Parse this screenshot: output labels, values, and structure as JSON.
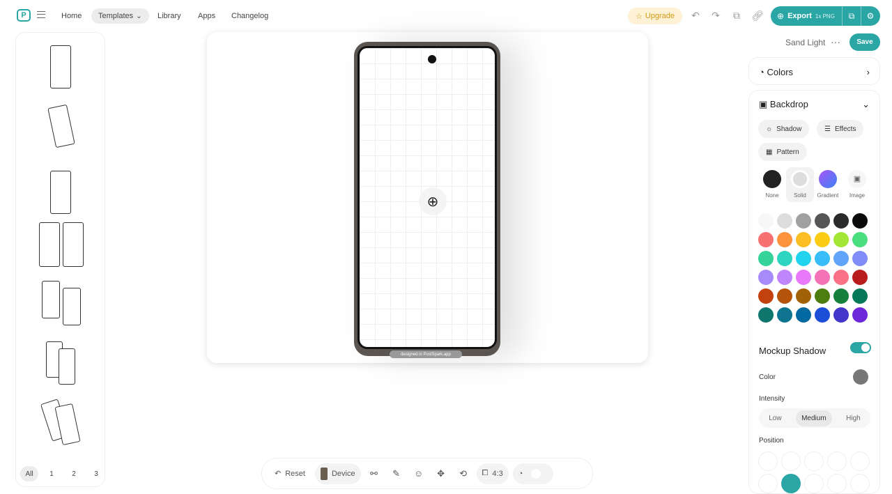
{
  "topbar": {
    "logo": "P",
    "nav": [
      "Home",
      "Templates",
      "Library",
      "Apps",
      "Changelog"
    ],
    "templates_suffix": "⌄",
    "upgrade": "Upgrade",
    "export_label": "Export",
    "export_meta": "1x PNG"
  },
  "sidebar": {
    "pages": [
      "All",
      "1",
      "2",
      "3"
    ]
  },
  "canvas": {
    "watermark": "designed in PostSpark.app"
  },
  "toolbar": {
    "reset": "Reset",
    "device": "Device",
    "ratio": "4:3"
  },
  "panel": {
    "theme": "Sand Light",
    "more": "···",
    "save": "Save",
    "colors": "Colors",
    "backdrop": "Backdrop",
    "chips": [
      "Shadow",
      "Effects",
      "Pattern"
    ],
    "bg_types": [
      "None",
      "Solid",
      "Gradient",
      "Image"
    ],
    "mockup_shadow": "Mockup Shadow",
    "color_label": "Color",
    "intensity_label": "Intensity",
    "intensity_options": [
      "Low",
      "Medium",
      "High"
    ],
    "intensity_selected": "Medium",
    "position_label": "Position"
  },
  "colors": {
    "accent": "#2aa6a5",
    "swatches": [
      "#f7f7f7",
      "#dddddd",
      "#a0a0a0",
      "#555555",
      "#2a2a2a",
      "#0a0a0a",
      "#f87171",
      "#fb923c",
      "#fbbf24",
      "#facc15",
      "#a3e635",
      "#4ade80",
      "#34d399",
      "#2dd4bf",
      "#22d3ee",
      "#38bdf8",
      "#60a5fa",
      "#818cf8",
      "#a78bfa",
      "#c084fc",
      "#e879f9",
      "#f472b6",
      "#fb7185",
      "#b91c1c",
      "#c2410c",
      "#b45309",
      "#a16207",
      "#4d7c0f",
      "#15803d",
      "#047857",
      "#0f766e",
      "#0e7490",
      "#0369a1",
      "#1d4ed8",
      "#4338ca",
      "#6d28d9"
    ]
  }
}
